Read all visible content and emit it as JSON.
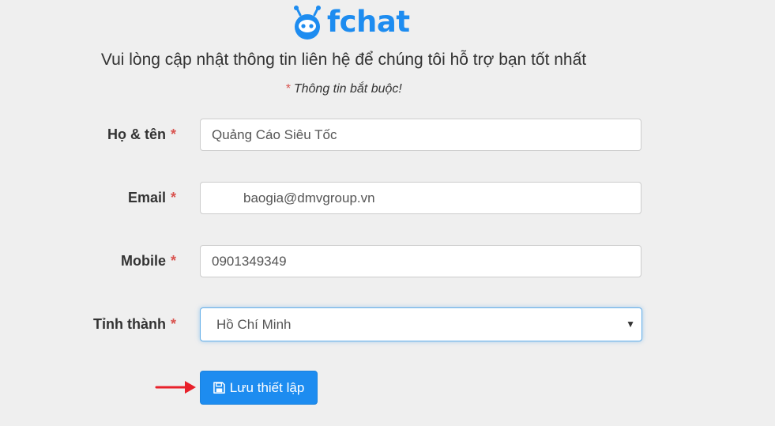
{
  "brand": {
    "name": "fchat",
    "color": "#1d8cf0"
  },
  "header": {
    "subtitle": "Vui lòng cập nhật thông tin liên hệ để chúng tôi hỗ trợ bạn tốt nhất",
    "required_note_asterisk": "*",
    "required_note": "Thông tin bắt buộc!"
  },
  "form": {
    "name": {
      "label": "Họ & tên",
      "required": "*",
      "value": "Quảng Cáo Siêu Tốc"
    },
    "email": {
      "label": "Email",
      "required": "*",
      "value": "baogia@dmvgroup.vn"
    },
    "mobile": {
      "label": "Mobile",
      "required": "*",
      "value": "0901349349"
    },
    "province": {
      "label": "Tỉnh thành",
      "required": "*",
      "selected": "Hồ Chí Minh",
      "caret": "▼"
    }
  },
  "actions": {
    "save_label": "Lưu thiết lập",
    "save_icon": "floppy-disk-icon"
  },
  "colors": {
    "required": "#d9534f",
    "primary": "#1d8cf0",
    "annotation_arrow": "#e8202a",
    "background": "#efefef"
  }
}
